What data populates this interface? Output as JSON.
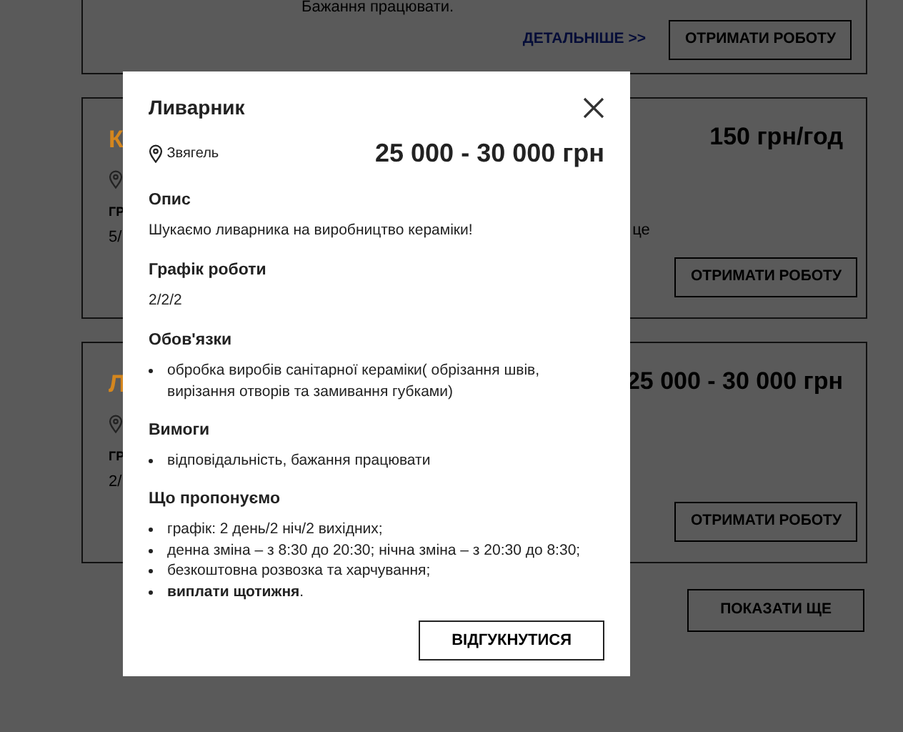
{
  "background": {
    "top_card": {
      "text": "Бажання працювати.",
      "details_link": "ДЕТАЛЬНІШЕ >>",
      "button": "ОТРИМАТИ РОБОТУ"
    },
    "cards": [
      {
        "title": "К",
        "price": "150 грн/год",
        "label": "ГР",
        "value": "5/",
        "extra": "це",
        "button": "ОТРИМАТИ РОБОТУ"
      },
      {
        "title": "Л",
        "price": "25 000 - 30 000 грн",
        "label": "ГР",
        "value": "2/",
        "button": "ОТРИМАТИ РОБОТУ"
      }
    ],
    "show_more": "ПОКАЗАТИ ЩЕ"
  },
  "modal": {
    "title": "Ливарник",
    "location": "Звягель",
    "salary": "25 000 - 30 000 грн",
    "sections": [
      {
        "heading": "Опис",
        "kind": "text",
        "text": "Шукаємо ливарника на виробництво кераміки!"
      },
      {
        "heading": "Графік роботи",
        "kind": "text",
        "text": "2/2/2"
      },
      {
        "heading": "Обов'язки",
        "kind": "list",
        "items": [
          "обробка виробів санітарної кераміки( обрізання швів, вирізання отворів та замивання губками)"
        ]
      },
      {
        "heading": "Вимоги",
        "kind": "list",
        "items": [
          "відповідальність, бажання працювати"
        ]
      },
      {
        "heading": "Що пропонуємо",
        "kind": "list",
        "items": [
          "графік: 2 день/2 ніч/2 вихідних;",
          "денна зміна – з 8:30 до 20:30; нічна зміна – з 20:30 до 8:30;",
          "безкоштовна розвозка та харчування;",
          "**виплати щотижня**."
        ]
      }
    ],
    "button": "ВІДГУКНУТИСЯ"
  }
}
